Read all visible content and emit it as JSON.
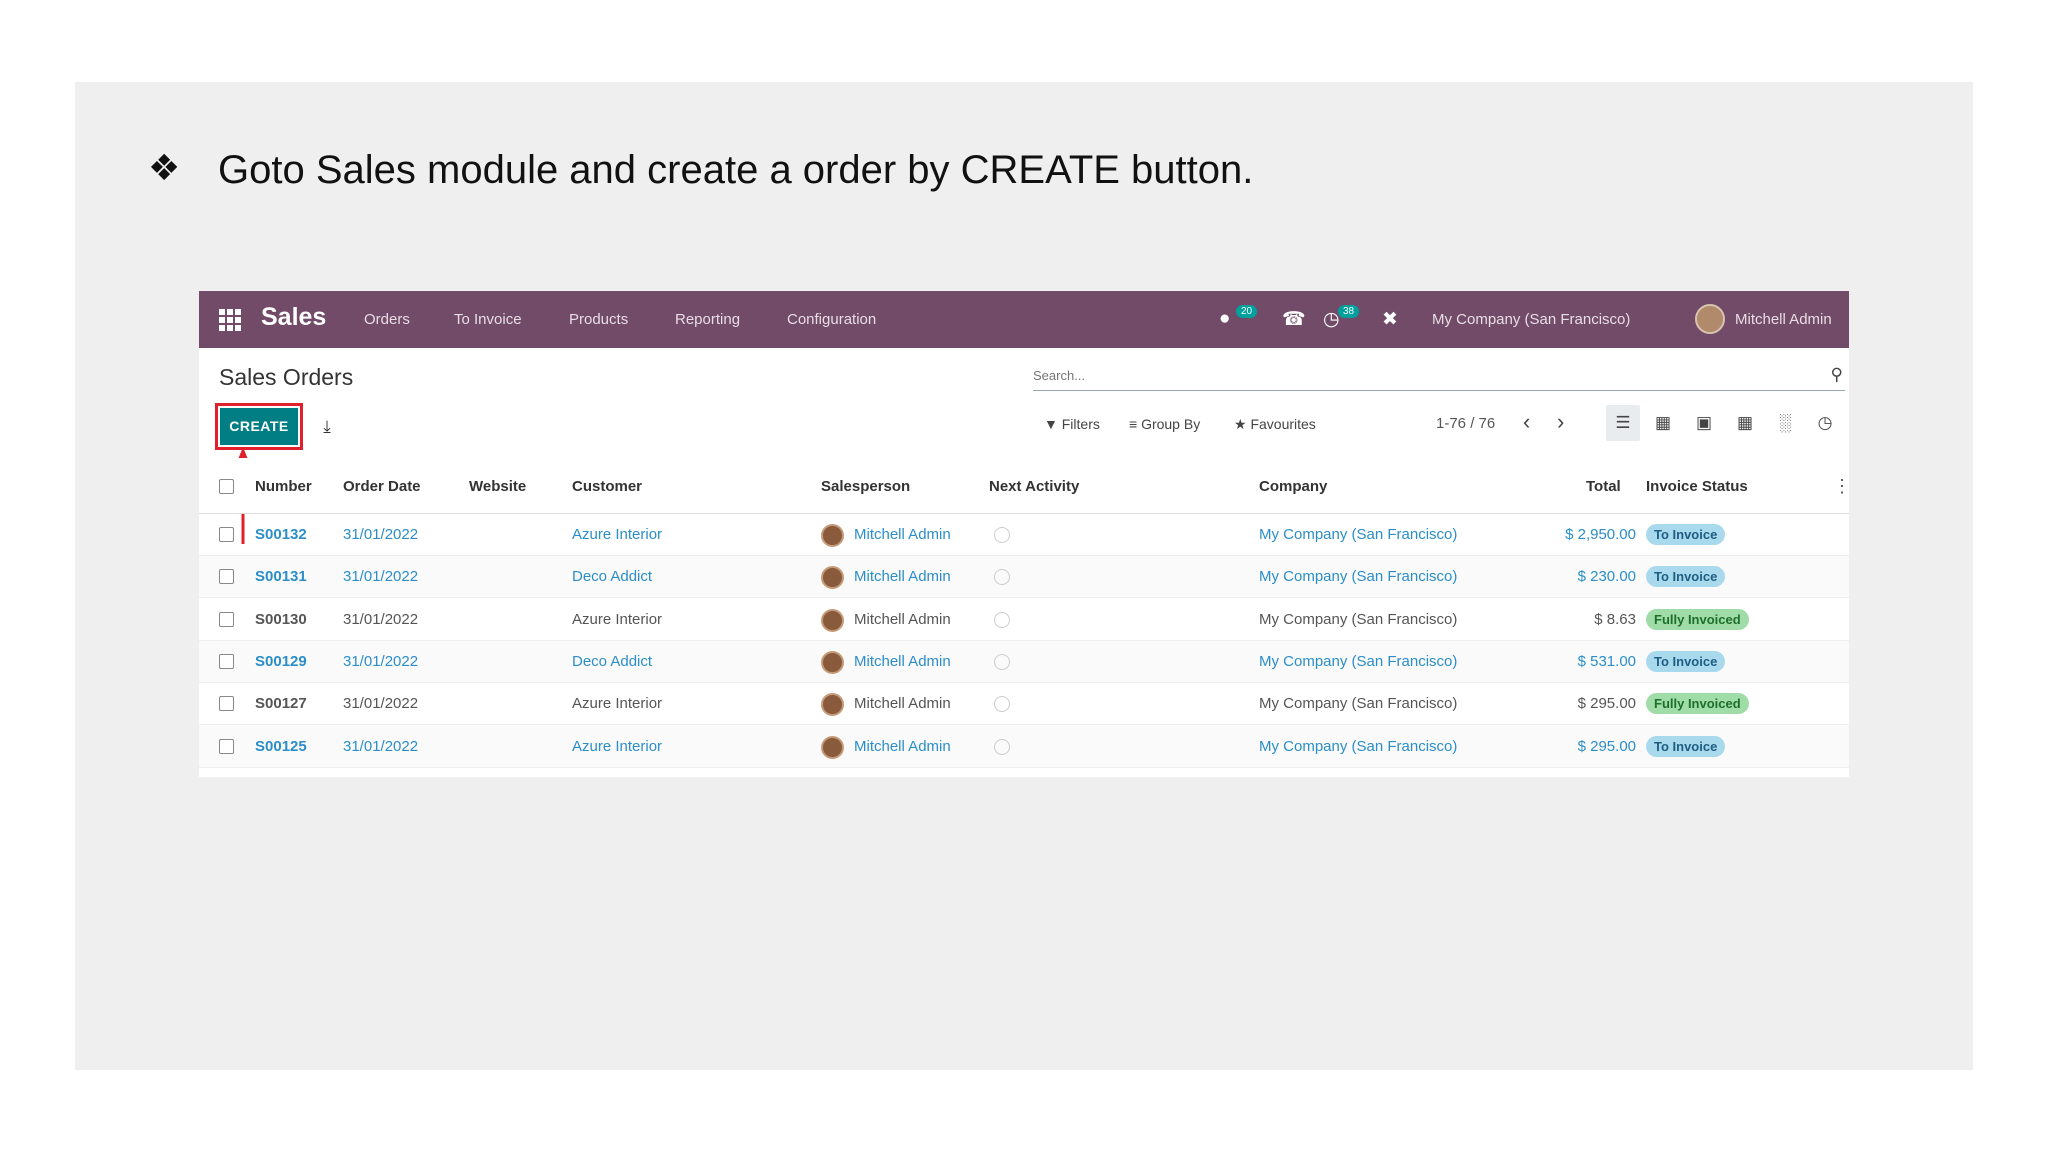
{
  "slide": {
    "bullet": "❖",
    "instruction": "Goto Sales module and create a order by CREATE button."
  },
  "navbar": {
    "app_name": "Sales",
    "menu": [
      "Orders",
      "To Invoice",
      "Products",
      "Reporting",
      "Configuration"
    ],
    "badges": {
      "messages": "20",
      "activities": "38"
    },
    "company": "My Company (San Francisco)",
    "user": "Mitchell Admin",
    "accent": "#714b67"
  },
  "control_panel": {
    "title": "Sales Orders",
    "search_placeholder": "Search...",
    "create_label": "CREATE",
    "filters": "Filters",
    "group_by": "Group By",
    "favourites": "Favourites",
    "pager": "1-76 / 76"
  },
  "table": {
    "columns": [
      "Number",
      "Order Date",
      "Website",
      "Customer",
      "Salesperson",
      "Next Activity",
      "Company",
      "Total",
      "Invoice Status"
    ],
    "rows": [
      {
        "number": "S00132",
        "date": "31/01/2022",
        "customer": "Azure Interior",
        "salesperson": "Mitchell Admin",
        "company": "My Company (San Francisco)",
        "total": "$ 2,950.00",
        "status": "To Invoice",
        "status_kind": "to",
        "linked": true
      },
      {
        "number": "S00131",
        "date": "31/01/2022",
        "customer": "Deco Addict",
        "salesperson": "Mitchell Admin",
        "company": "My Company (San Francisco)",
        "total": "$ 230.00",
        "status": "To Invoice",
        "status_kind": "to",
        "linked": true
      },
      {
        "number": "S00130",
        "date": "31/01/2022",
        "customer": "Azure Interior",
        "salesperson": "Mitchell Admin",
        "company": "My Company (San Francisco)",
        "total": "$ 8.63",
        "status": "Fully Invoiced",
        "status_kind": "full",
        "linked": false
      },
      {
        "number": "S00129",
        "date": "31/01/2022",
        "customer": "Deco Addict",
        "salesperson": "Mitchell Admin",
        "company": "My Company (San Francisco)",
        "total": "$ 531.00",
        "status": "To Invoice",
        "status_kind": "to",
        "linked": true
      },
      {
        "number": "S00127",
        "date": "31/01/2022",
        "customer": "Azure Interior",
        "salesperson": "Mitchell Admin",
        "company": "My Company (San Francisco)",
        "total": "$ 295.00",
        "status": "Fully Invoiced",
        "status_kind": "full",
        "linked": false
      },
      {
        "number": "S00125",
        "date": "31/01/2022",
        "customer": "Azure Interior",
        "salesperson": "Mitchell Admin",
        "company": "My Company (San Francisco)",
        "total": "$ 295.00",
        "status": "To Invoice",
        "status_kind": "to",
        "linked": true
      }
    ]
  },
  "icons": {
    "apps": "apps-grid-icon",
    "chat": "chat-icon",
    "phone": "phone-icon",
    "activity": "clock-icon",
    "close": "close-icon",
    "download": "download-icon",
    "search": "search-icon"
  },
  "colors": {
    "create_button": "#017e84",
    "highlight": "#e0202a",
    "link": "#2b8ec8"
  }
}
